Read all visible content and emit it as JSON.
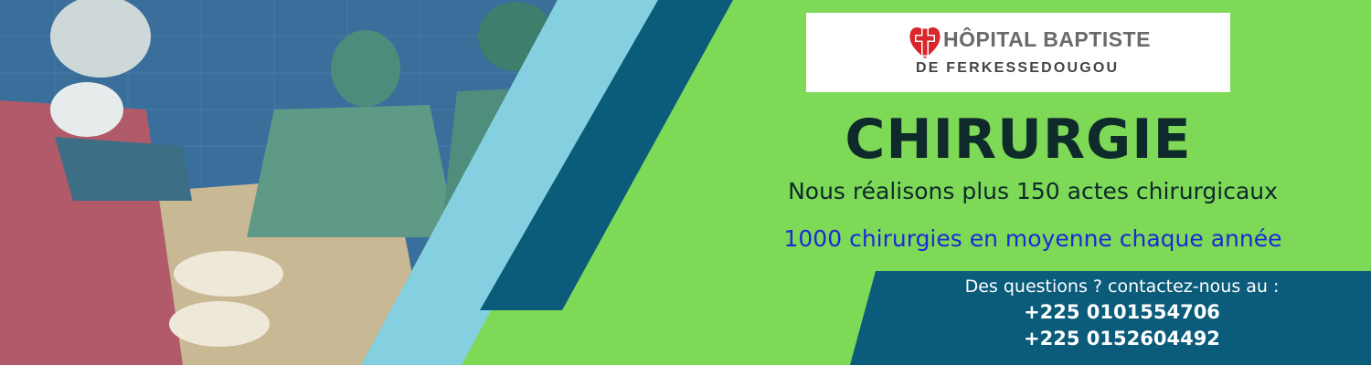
{
  "colors": {
    "green": "#7ed957",
    "dark_teal": "#0a5c7a",
    "light_blue": "#84d0e0",
    "title_text": "#0e2a2a",
    "stat_text": "#1a2ad6",
    "logo_red": "#d8262a"
  },
  "logo": {
    "icon": "cross-heart-logo-icon",
    "line1": "HÔPITAL BAPTISTE",
    "line2": "DE FERKESSEDOUGOU"
  },
  "title": "CHIRURGIE",
  "subtitle": "Nous réalisons plus 150 actes chirurgicaux",
  "stat": "1000 chirurgies en moyenne chaque année",
  "contact": {
    "intro": "Des questions ? contactez-nous au :",
    "phones": [
      "+225 0101554706",
      "+225 0152604492"
    ]
  }
}
